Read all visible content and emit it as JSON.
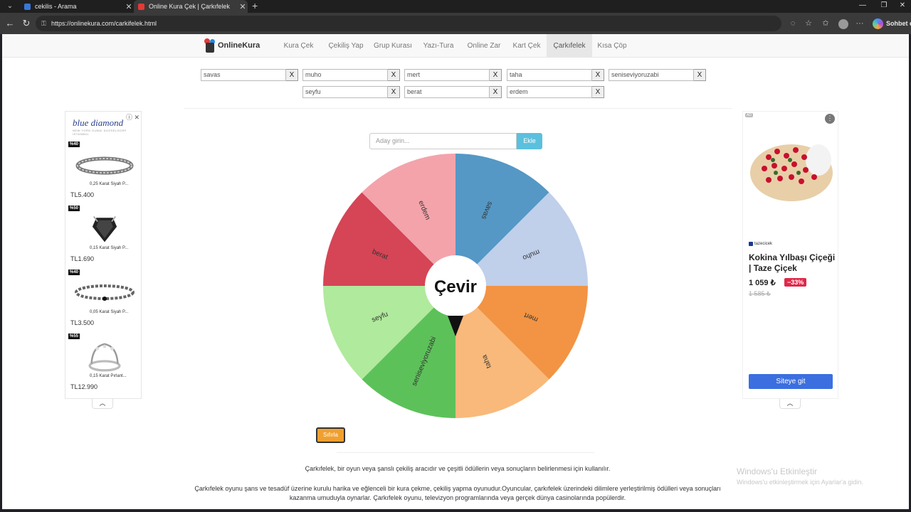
{
  "browser": {
    "tabs": [
      {
        "label": "cekilis - Arama",
        "close": "✕"
      },
      {
        "label": "Online Kura Çek | Çarkıfelek",
        "close": "✕"
      }
    ],
    "url": "https://onlinekura.com/carkifelek.html",
    "sidebar_label": "Sohbet et"
  },
  "site": {
    "logo_text": "OnlineKura",
    "nav": [
      {
        "label": "Kura Çek"
      },
      {
        "label": "Çekiliş Yap"
      },
      {
        "label": "Grup Kurası"
      },
      {
        "label": "Yazı-Tura"
      },
      {
        "label": "Online Zar"
      },
      {
        "label": "Kart Çek"
      },
      {
        "label": "Çarkıfelek",
        "active": true
      },
      {
        "label": "Kısa Çöp"
      }
    ]
  },
  "candidates": [
    "savas",
    "muho",
    "mert",
    "taha",
    "seniseviyoruzabi",
    "seyfu",
    "berat",
    "erdem"
  ],
  "remove_label": "X",
  "add_form": {
    "placeholder": "Aday girin...",
    "button": "Ekle"
  },
  "wheel": {
    "center_label": "Çevir",
    "segments": [
      {
        "label": "savas",
        "color": "#5598c5"
      },
      {
        "label": "muho",
        "color": "#c0cfea"
      },
      {
        "label": "mert",
        "color": "#f29443"
      },
      {
        "label": "taha",
        "color": "#f8b97b"
      },
      {
        "label": "seniseviyoruzabi",
        "color": "#5dc15a"
      },
      {
        "label": "seyfu",
        "color": "#b0ea9c"
      },
      {
        "label": "berat",
        "color": "#d54556"
      },
      {
        "label": "erdem",
        "color": "#f4a3ab"
      }
    ],
    "pointer_color": "#111111"
  },
  "reset_button": "Sıfırla",
  "description": {
    "line1": "Çarkıfelek, bir oyun veya şanslı çekiliş aracıdır ve çeşitli ödüllerin veya sonuçların belirlenmesi için kullanılır.",
    "line2": "Çarkıfelek oyunu şans ve tesadüf üzerine kurulu harika ve eğlenceli bir kura çekme, çekiliş yapma oyunudur.Oyuncular, çarkıfelek üzerindeki dilimlere yerleştirilmiş ödülleri veya sonuçları kazanma umuduyla oynarlar. Çarkıfelek oyunu, televizyon programlarında veya gerçek dünya casinolarında popülerdir."
  },
  "left_ad": {
    "brand": "blue diamond",
    "brand_sub": "NEW YORK  DUBAI  DUSSELDORF  ISTANBUL",
    "products": [
      {
        "discount": "%40",
        "name": "0,25 Karat Siyah P...",
        "price": "TL5.400",
        "kind": "ring-braid"
      },
      {
        "discount": "%50",
        "name": "0,15 Karat Siyah P...",
        "price": "TL1.690",
        "kind": "ring-stone"
      },
      {
        "discount": "%40",
        "name": "0,05 Karat Siyah P...",
        "price": "TL3.500",
        "kind": "bracelet"
      },
      {
        "discount": "%55",
        "name": "0,15 Karat Pırlant...",
        "price": "TL12.990",
        "kind": "ring-crown"
      }
    ]
  },
  "right_ad": {
    "badge": "AD",
    "brand": "tazecicek",
    "title": "Kokina Yılbaşı Çiçeği | Taze Çiçek",
    "price": "1 059 ₺",
    "discount": "−33%",
    "old_price": "1 585 ₺",
    "cta": "Siteye git"
  },
  "windows_activation": {
    "line1": "Windows'u Etkinleştir",
    "line2": "Windows'u etkinleştirmek için Ayarlar'a gidin."
  },
  "icons": [
    "tab-menu-icon",
    "back-icon",
    "reload-icon",
    "lock-icon",
    "star-icon",
    "favorites-icon",
    "more-icon",
    "copilot-icon",
    "close-icon",
    "chevron-up-icon",
    "plus-icon"
  ]
}
